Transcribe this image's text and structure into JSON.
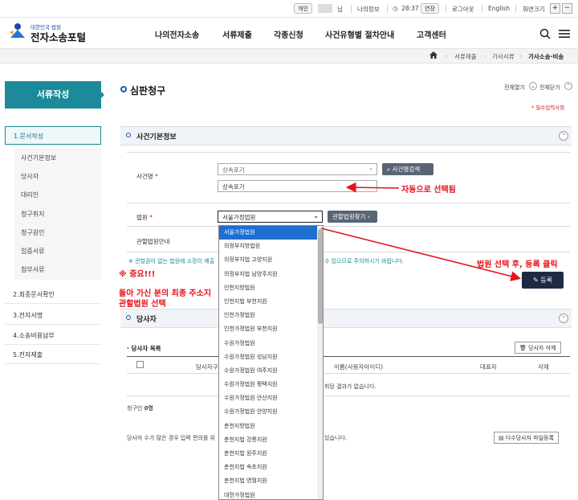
{
  "util": {
    "personal": "개인",
    "user_suffix": "님",
    "my_info": "나의정보",
    "timer": "28:37",
    "extend": "연장",
    "logout": "로그아웃",
    "english": "English",
    "zoom": "화면크기",
    "zoom_in": "+",
    "zoom_out": "−"
  },
  "header": {
    "logo_sub": "대한민국 법원",
    "logo_title": "전자소송포털",
    "nav": [
      "나의전자소송",
      "서류제출",
      "각종신청",
      "사건유형별 절차안내",
      "고객센터"
    ]
  },
  "breadcrumb": [
    "서류제출",
    "가사서류",
    "가사소송·비송"
  ],
  "sidebar": {
    "title": "서류작성",
    "steps": [
      "1.문서작성",
      "2.최종문서확인",
      "3.전자서명",
      "4.소송비용납부",
      "5.전자제출"
    ],
    "subs": [
      "사건기본정보",
      "당사자",
      "대리인",
      "청구취지",
      "청구원인",
      "입증서류",
      "첨부서류"
    ]
  },
  "main": {
    "title": "심판청구",
    "expand_all": "전체열기",
    "collapse_all": "전체닫기",
    "required_note": "* 필수입력사항",
    "section1": "사건기본정보",
    "case_name_label": "사건명",
    "case_select_value": "상속포기",
    "case_search_btn": "사건명검색",
    "case_name_value": "상속포기",
    "court_label": "법원",
    "court_value": "서울가정법원",
    "court_find_btn": "관할법원찾기",
    "jurisdiction_label": "관할법원안내",
    "notice_left": "※ 관할권이 없는 법원에 소장이 제출",
    "notice_right": "수 있으므로 주의하시기 바랍니다.",
    "register_btn": "등록",
    "section2": "당사자",
    "party_list": "당사자 목록",
    "party_delete": "당사자 삭제",
    "col_type": "당사자구",
    "col_name": "이름(사용자아이디)",
    "col_rep": "대표자",
    "col_del": "삭제",
    "empty": "회된 결과가 없습니다.",
    "claimant_label": "청구인",
    "claimant_count": "0명",
    "bulk_note_left": "당사자 수가 많은 경우 입력 편의를 위",
    "bulk_note_right": "있습니다.",
    "bulk_btn": "다수당사자 파일등록"
  },
  "dropdown_options": [
    "서울가정법원",
    "의정부지방법원",
    "의정부지법 고양지원",
    "의정부지법 남양주지원",
    "인천지방법원",
    "인천지법 부천지원",
    "인천가정법원",
    "인천가정법원 부천지원",
    "수원가정법원",
    "수원가정법원 성남지원",
    "수원가정법원 여주지원",
    "수원가정법원 평택지원",
    "수원가정법원 안산지원",
    "수원가정법원 안양지원",
    "춘천지방법원",
    "춘천지법 강릉지원",
    "춘천지법 원주지원",
    "춘천지법 속초지원",
    "춘천지법 영월지원",
    "대전가정법원"
  ],
  "annotations": {
    "auto_selected": "자동으로 선택됨",
    "after_select": "법원 선택 후, 등록 클릭",
    "important": "※ 중요!!!",
    "guide_line1": "돌아 가신 분의 최종 주소지",
    "guide_line2": "관할법원 선택"
  },
  "colors": {
    "accent": "#1c8a99",
    "annotation": "#e8111a",
    "register": "#1e2a44",
    "selected": "#1e6fd0"
  }
}
